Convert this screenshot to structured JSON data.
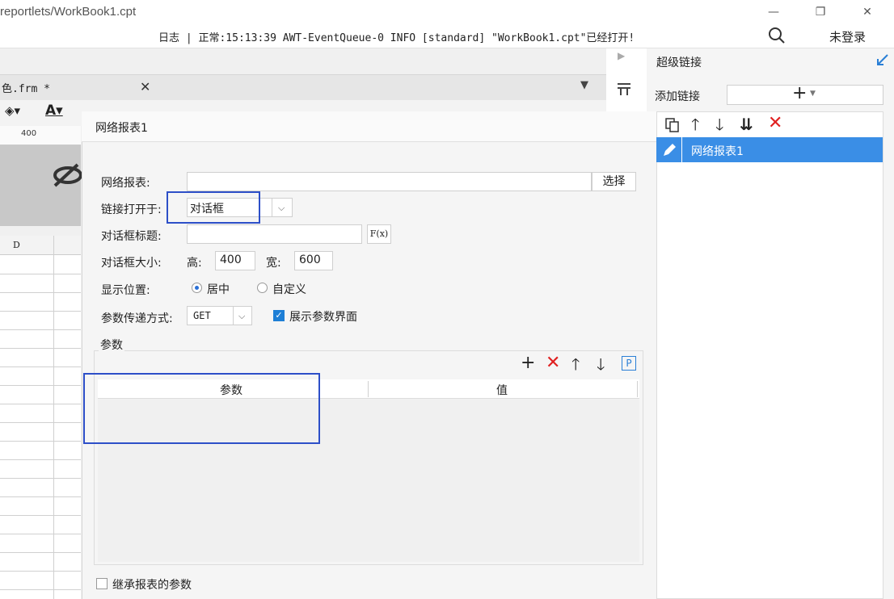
{
  "window": {
    "title_path": "reportlets/WorkBook1.cpt",
    "minimize": "—",
    "restore": "❐",
    "close": "✕"
  },
  "log": {
    "text": "日志 | 正常:15:13:39 AWT-EventQueue-0 INFO [standard] \"WorkBook1.cpt\"已经打开!"
  },
  "user": {
    "login_label": "未登录"
  },
  "editor": {
    "tab_label": "色.frm *",
    "tab_close": "✕",
    "ruler_label": "400",
    "column_label": "D"
  },
  "dialog": {
    "title": "网络报表1",
    "report_label": "网络报表:",
    "report_value": "",
    "choose_button": "选择",
    "open_in_label": "链接打开于:",
    "open_in_value": "对话框",
    "dialog_title_label": "对话框标题:",
    "dialog_title_value": "",
    "formula_button": "F(x)",
    "size_label": "对话框大小:",
    "height_label": "高:",
    "height_value": "400",
    "width_label": "宽:",
    "width_value": "600",
    "position_label": "显示位置:",
    "position_options": [
      "居中",
      "自定义"
    ],
    "position_selected": "居中",
    "param_method_label": "参数传递方式:",
    "param_method_value": "GET",
    "show_param_label": "展示参数界面",
    "show_param_checked": true,
    "params_group_label": "参数",
    "params_columns": [
      "参数",
      "值"
    ],
    "params_rows": [],
    "inherit_label": "继承报表的参数",
    "inherit_checked": false
  },
  "hyperlink_panel": {
    "title": "超级链接",
    "add_label": "添加链接",
    "add_button": "+",
    "items": [
      {
        "label": "网络报表1",
        "selected": true
      }
    ]
  },
  "colors": {
    "accent": "#3a8ee6",
    "highlight_box": "#2d4fc8",
    "delete_red": "#e02020"
  }
}
